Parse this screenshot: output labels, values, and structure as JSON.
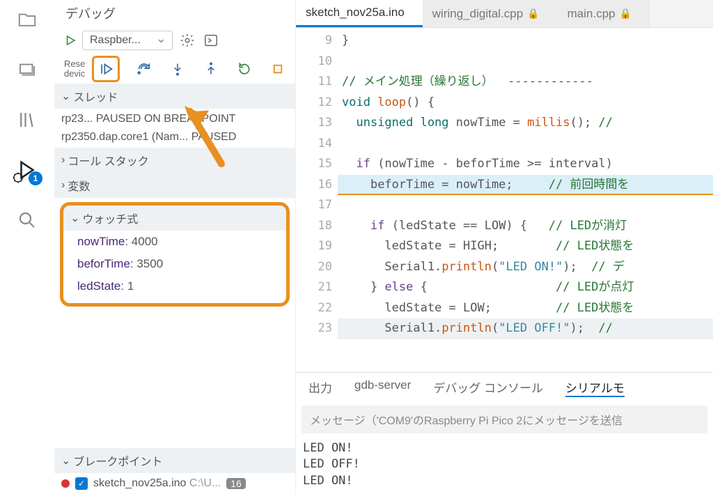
{
  "panel_title": "デバッグ",
  "debug_config": "Raspber...",
  "reset_text": "Rese\ndevic",
  "debug_badge": "1",
  "sections": {
    "threads": "スレッド",
    "callstack": "コール スタック",
    "variables": "変数",
    "watch": "ウォッチ式",
    "breakpoints": "ブレークポイント"
  },
  "threads": [
    "rp23... PAUSED ON BREAKPOINT",
    "rp2350.dap.core1 (Nam... PAUSED"
  ],
  "watch": [
    {
      "name": "nowTime",
      "value": "4000"
    },
    {
      "name": "beforTime",
      "value": "3500"
    },
    {
      "name": "ledState",
      "value": "1"
    }
  ],
  "breakpoint": {
    "file": "sketch_nov25a.ino",
    "path": "C:\\U...",
    "line": "16"
  },
  "tabs": [
    {
      "label": "sketch_nov25a.ino",
      "active": true,
      "locked": false
    },
    {
      "label": "wiring_digital.cpp",
      "active": false,
      "locked": true
    },
    {
      "label": "main.cpp",
      "active": false,
      "locked": true
    }
  ],
  "code": {
    "start": 9,
    "lines": [
      {
        "n": 9,
        "html": "<span class='c-txt'>}</span>"
      },
      {
        "n": 10,
        "html": ""
      },
      {
        "n": 11,
        "html": "<span class='c-comment'>// メイン処理（繰り返し）  ------------</span>"
      },
      {
        "n": 12,
        "html": "<span class='c-keyword'>void</span> <span class='c-func'>loop</span><span class='c-txt'>() {</span>"
      },
      {
        "n": 13,
        "html": "  <span class='c-keyword'>unsigned long</span> <span class='c-txt'>nowTime = </span><span class='c-func'>millis</span><span class='c-txt'>();</span> <span class='c-comment'>// </span>"
      },
      {
        "n": 14,
        "html": ""
      },
      {
        "n": 15,
        "html": "  <span class='c-ctrl'>if</span> <span class='c-txt'>(nowTime - beforTime &gt;= interval) </span>"
      },
      {
        "n": 16,
        "html": "    <span class='c-txt'>beforTime = nowTime;</span>     <span class='c-comment'>// 前回時間を</span>",
        "bp": true,
        "hl": true
      },
      {
        "n": 17,
        "html": ""
      },
      {
        "n": 18,
        "html": "    <span class='c-ctrl'>if</span> <span class='c-txt'>(ledState == LOW) {</span>   <span class='c-comment'>// LEDが消灯</span>"
      },
      {
        "n": 19,
        "html": "      <span class='c-txt'>ledState = HIGH;</span>        <span class='c-comment'>// LED状態を</span>"
      },
      {
        "n": 20,
        "html": "      <span class='c-txt'>Serial1.</span><span class='c-func'>println</span><span class='c-txt'>(</span><span class='c-str'>\"LED ON!\"</span><span class='c-txt'>);</span>  <span class='c-comment'>// デ</span>"
      },
      {
        "n": 21,
        "html": "    <span class='c-txt'>} </span><span class='c-ctrl'>else</span><span class='c-txt'> {</span>                  <span class='c-comment'>// LEDが点灯</span>"
      },
      {
        "n": 22,
        "html": "      <span class='c-txt'>ledState = LOW;</span>         <span class='c-comment'>// LED状態を</span>"
      },
      {
        "n": 23,
        "html": "      <span class='c-txt'>Serial1.</span><span class='c-func'>println</span><span class='c-txt'>(</span><span class='c-str'>\"LED OFF!\"</span><span class='c-txt'>);</span>  <span class='c-comment'>//</span>",
        "dim": true
      }
    ]
  },
  "bottom_tabs": [
    "出力",
    "gdb-server",
    "デバッグ コンソール",
    "シリアルモ"
  ],
  "serial_placeholder": "メッセージ（'COM9'のRaspberry Pi Pico 2にメッセージを送信",
  "serial_output": [
    "LED ON!",
    "LED OFF!",
    "LED ON!"
  ]
}
